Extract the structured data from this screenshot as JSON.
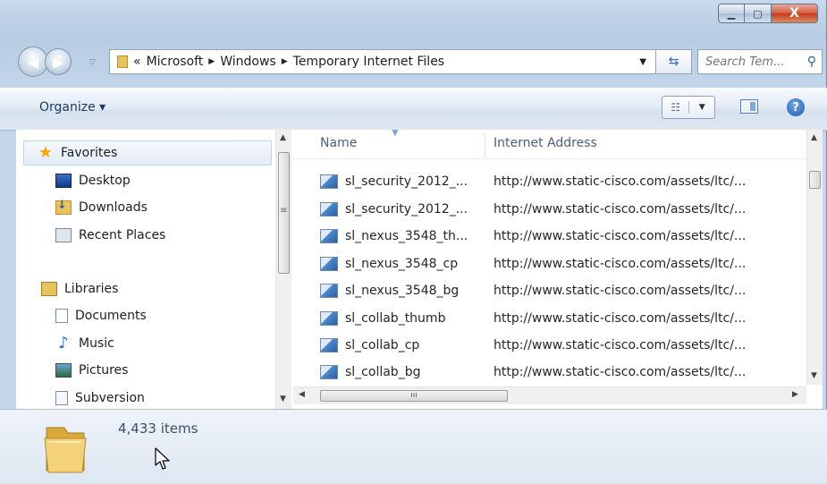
{
  "window": {
    "caption": {
      "minimize": "▁",
      "maximize": "▢",
      "close": "X"
    }
  },
  "address": {
    "overflow": "«",
    "crumbs": [
      "Microsoft",
      "Windows",
      "Temporary Internet Files"
    ],
    "search_placeholder": "Search Tem..."
  },
  "toolbar": {
    "organize": "Organize ▾"
  },
  "nav": {
    "favorites": "Favorites",
    "desktop": "Desktop",
    "downloads": "Downloads",
    "recent": "Recent Places",
    "libraries": "Libraries",
    "documents": "Documents",
    "music": "Music",
    "pictures": "Pictures",
    "subversion": "Subversion"
  },
  "list": {
    "columns": {
      "name": "Name",
      "address": "Internet Address"
    },
    "rows": [
      {
        "name": "sl_security_2012_...",
        "url": "http://www.static-cisco.com/assets/ltc/..."
      },
      {
        "name": "sl_security_2012_...",
        "url": "http://www.static-cisco.com/assets/ltc/..."
      },
      {
        "name": "sl_nexus_3548_th...",
        "url": "http://www.static-cisco.com/assets/ltc/..."
      },
      {
        "name": "sl_nexus_3548_cp",
        "url": "http://www.static-cisco.com/assets/ltc/..."
      },
      {
        "name": "sl_nexus_3548_bg",
        "url": "http://www.static-cisco.com/assets/ltc/..."
      },
      {
        "name": "sl_collab_thumb",
        "url": "http://www.static-cisco.com/assets/ltc/..."
      },
      {
        "name": "sl_collab_cp",
        "url": "http://www.static-cisco.com/assets/ltc/..."
      },
      {
        "name": "sl_collab_bg",
        "url": "http://www.static-cisco.com/assets/ltc/..."
      }
    ]
  },
  "details": {
    "count": "4,433 items"
  }
}
